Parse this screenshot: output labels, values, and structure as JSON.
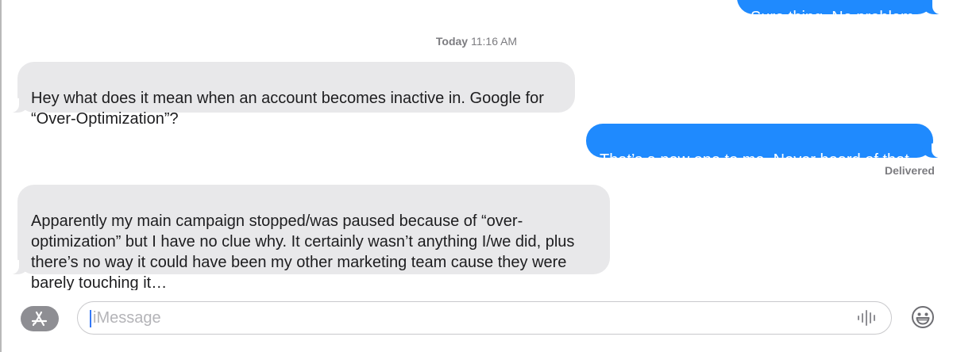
{
  "conversation": {
    "partial_top_message": "Sure thing. No problem.",
    "timestamp_day": "Today",
    "timestamp_time": "11:16 AM",
    "messages": [
      {
        "direction": "received",
        "text": "Hey what does it mean when an account becomes inactive in. Google for\n“Over-Optimization”?"
      },
      {
        "direction": "sent",
        "text": "That’s a new one to me. Never heard of that."
      },
      {
        "direction": "received",
        "text": "Apparently my main campaign stopped/was paused because of “over-\noptimization” but I have no clue why. It certainly wasn’t anything I/we did, plus\nthere’s no way it could have been my other marketing team cause they were\nbarely touching it…"
      }
    ],
    "delivery_status": "Delivered"
  },
  "input_bar": {
    "placeholder": "iMessage",
    "apps_button_icon": "app-store-icon",
    "audio_icon": "audio-waveform-icon",
    "emoji_icon": "emoji-icon"
  },
  "colors": {
    "sent_bubble": "#1f8afe",
    "received_bubble": "#e8e8ea",
    "caret": "#3478f6"
  }
}
